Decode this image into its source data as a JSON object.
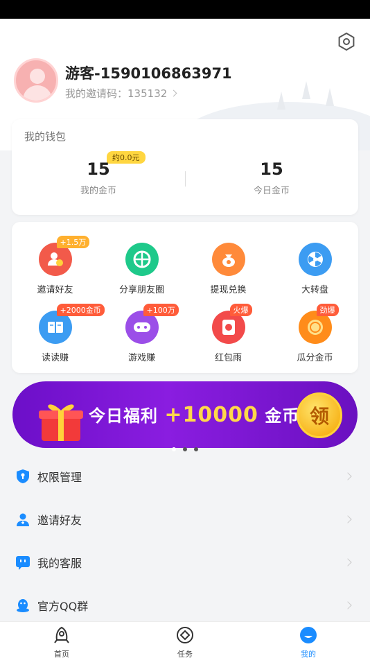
{
  "profile": {
    "username": "游客-1590106863971",
    "invite_label": "我的邀请码：",
    "invite_code": "135132"
  },
  "wallet": {
    "title": "我的钱包",
    "my_coins": {
      "value": "15",
      "label": "我的金币",
      "badge": "约0.0元"
    },
    "today_coins": {
      "value": "15",
      "label": "今日金币"
    }
  },
  "features": [
    {
      "label": "邀请好友",
      "tag": "+1.5万",
      "icon": "invite-user-icon",
      "color": "#f25a4a"
    },
    {
      "label": "分享朋友圈",
      "tag": "",
      "icon": "moments-icon",
      "color": "#1ec98a"
    },
    {
      "label": "提现兑换",
      "tag": "",
      "icon": "money-bag-icon",
      "color": "#ff8a3a"
    },
    {
      "label": "大转盘",
      "tag": "",
      "icon": "wheel-icon",
      "color": "#3c9cf2"
    },
    {
      "label": "读读赚",
      "tag": "+2000金币",
      "icon": "book-icon",
      "color": "#3c9cf2"
    },
    {
      "label": "游戏赚",
      "tag": "+100万",
      "icon": "gamepad-icon",
      "color": "#9b4ee8"
    },
    {
      "label": "红包雨",
      "tag": "火爆",
      "icon": "red-packet-icon",
      "color": "#f24a4a"
    },
    {
      "label": "瓜分金币",
      "tag": "劲爆",
      "icon": "coin-icon",
      "color": "#ff8c1a"
    }
  ],
  "banner": {
    "text_prefix": "今日福利 ",
    "amount": "+10000",
    "text_suffix": " 金币",
    "claim_label": "领"
  },
  "menu": [
    {
      "label": "权限管理",
      "icon": "shield-icon"
    },
    {
      "label": "邀请好友",
      "icon": "add-user-icon"
    },
    {
      "label": "我的客服",
      "icon": "chat-bubble-icon"
    },
    {
      "label": "官方QQ群",
      "icon": "qq-penguin-icon"
    }
  ],
  "tabs": [
    {
      "label": "首页",
      "icon": "home-rocket-icon"
    },
    {
      "label": "任务",
      "icon": "task-icon"
    },
    {
      "label": "我的",
      "icon": "profile-icon"
    }
  ],
  "colors": {
    "accent": "#1a8cff",
    "banner": "#7a16d6"
  }
}
